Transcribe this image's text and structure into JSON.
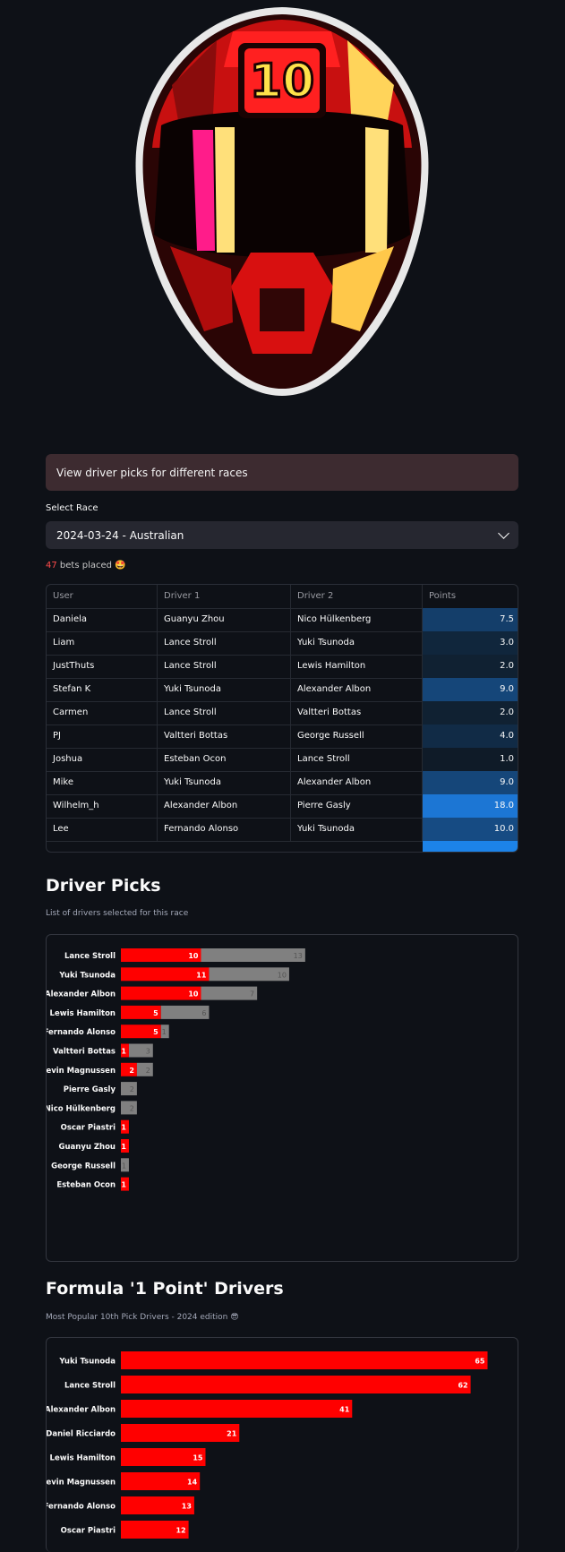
{
  "logo": {
    "helmet_number": "10"
  },
  "info": {
    "text": "View driver picks for different races"
  },
  "race_select": {
    "label": "Select Race",
    "value": "2024-03-24 - Australian"
  },
  "bets": {
    "count": "47",
    "text": " bets placed 🤩"
  },
  "table": {
    "columns": [
      "User",
      "Driver 1",
      "Driver 2",
      "Points"
    ],
    "rows": [
      {
        "user": "Daniela",
        "driver1": "Guanyu Zhou",
        "driver2": "Nico Hülkenberg",
        "points": "7.5"
      },
      {
        "user": "Liam",
        "driver1": "Lance Stroll",
        "driver2": "Yuki Tsunoda",
        "points": "3.0"
      },
      {
        "user": "JustThuts",
        "driver1": "Lance Stroll",
        "driver2": "Lewis Hamilton",
        "points": "2.0"
      },
      {
        "user": "Stefan K",
        "driver1": "Yuki Tsunoda",
        "driver2": "Alexander Albon",
        "points": "9.0"
      },
      {
        "user": "Carmen",
        "driver1": "Lance Stroll",
        "driver2": "Valtteri Bottas",
        "points": "2.0"
      },
      {
        "user": "PJ",
        "driver1": "Valtteri Bottas",
        "driver2": "George Russell",
        "points": "4.0"
      },
      {
        "user": "Joshua",
        "driver1": "Esteban Ocon",
        "driver2": "Lance Stroll",
        "points": "1.0"
      },
      {
        "user": "Mike",
        "driver1": "Yuki Tsunoda",
        "driver2": "Alexander Albon",
        "points": "9.0"
      },
      {
        "user": "Wilhelm_h",
        "driver1": "Alexander Albon",
        "driver2": "Pierre Gasly",
        "points": "18.0"
      },
      {
        "user": "Lee",
        "driver1": "Fernando Alonso",
        "driver2": "Yuki Tsunoda",
        "points": "10.0"
      }
    ]
  },
  "driver_picks": {
    "title": "Driver Picks",
    "caption": "List of drivers selected for this race"
  },
  "one_point": {
    "title": "Formula '1 Point' Drivers",
    "caption": "Most Popular 10th Pick Drivers - 2024 edition 😎"
  },
  "colors": {
    "red": "#ff0000",
    "gray": "#808080",
    "bg": "#0e1117"
  },
  "chart_data": [
    {
      "type": "bar",
      "orientation": "horizontal",
      "stacked": true,
      "categories": [
        "Lance Stroll",
        "Yuki Tsunoda",
        "Alexander Albon",
        "Lewis Hamilton",
        "Fernando Alonso",
        "Valtteri Bottas",
        "Kevin Magnussen",
        "Pierre Gasly",
        "Nico Hülkenberg",
        "Oscar Piastri",
        "Guanyu Zhou",
        "George Russell",
        "Esteban Ocon"
      ],
      "series": [
        {
          "color": "#ff0000",
          "values": [
            10,
            11,
            10,
            5,
            5,
            1,
            2,
            0,
            0,
            1,
            1,
            0,
            1
          ]
        },
        {
          "color": "#808080",
          "values": [
            13,
            10,
            7,
            6,
            1,
            3,
            2,
            2,
            2,
            0,
            0,
            1,
            0
          ]
        }
      ]
    },
    {
      "type": "bar",
      "orientation": "horizontal",
      "categories": [
        "Yuki Tsunoda",
        "Lance Stroll",
        "Alexander Albon",
        "Daniel Ricciardo",
        "Lewis Hamilton",
        "Kevin Magnussen",
        "Fernando Alonso",
        "Oscar Piastri"
      ],
      "values": [
        65,
        62,
        41,
        21,
        15,
        14,
        13,
        12
      ],
      "color": "#ff0000"
    }
  ]
}
